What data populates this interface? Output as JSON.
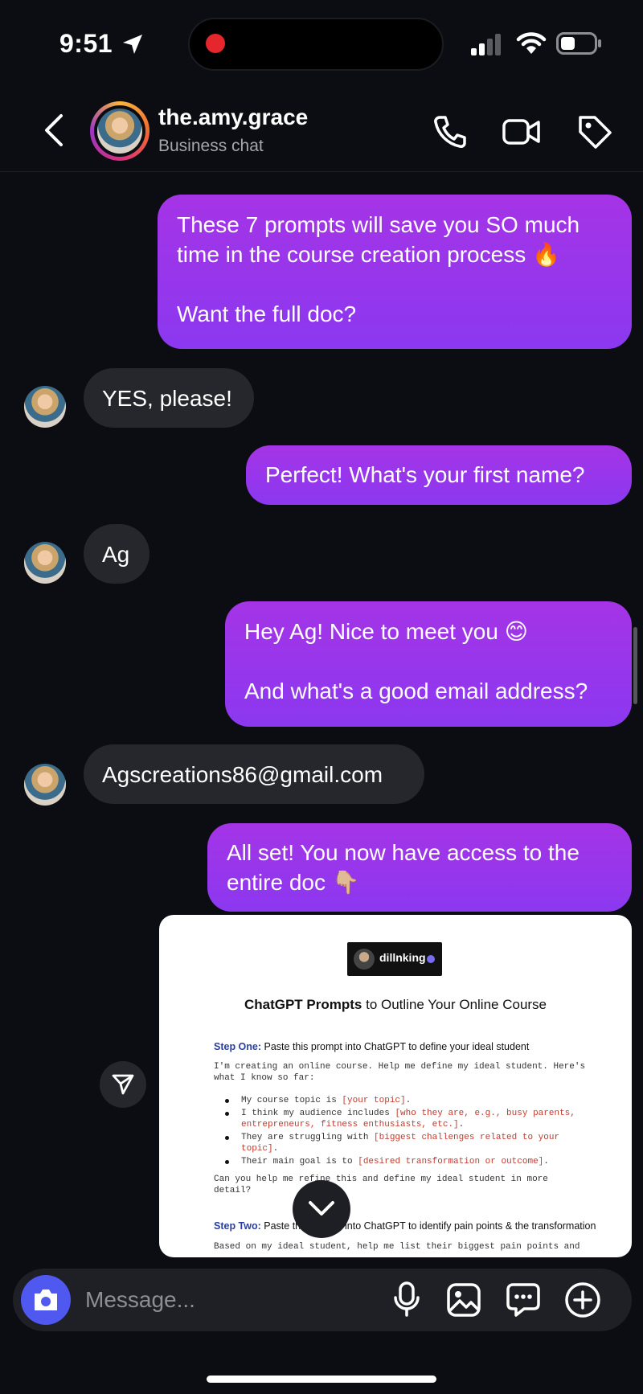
{
  "status_bar": {
    "time": "9:51"
  },
  "header": {
    "username": "the.amy.grace",
    "subtitle": "Business chat"
  },
  "messages": [
    {
      "from": "me",
      "text": "These 7 prompts will save you SO much\ntime in the course creation process 🔥\n\nWant the full doc?"
    },
    {
      "from": "them",
      "text": "YES, please!"
    },
    {
      "from": "me",
      "text": "Perfect! What's your first name?"
    },
    {
      "from": "them",
      "text": "Ag"
    },
    {
      "from": "me",
      "text": "Hey Ag! Nice to meet you 😊\n\nAnd what's a good email address?"
    },
    {
      "from": "them",
      "text": "Agscreations86@gmail.com"
    },
    {
      "from": "me",
      "text": "All set! You now have access to the\nentire doc 👇🏼"
    }
  ],
  "doc": {
    "logo_name": "dillnking",
    "title_bold": "ChatGPT Prompts",
    "title_rest": " to Outline Your Online Course",
    "step1_label": "Step One:",
    "step1_text": " Paste this prompt into ChatGPT to define your ideal student",
    "intro_line1": "I'm creating an online course. Help me define my ideal student. Here's",
    "intro_line2": "what I know so far:",
    "b1_a": "My course topic is ",
    "b1_b": "[your topic]",
    "b1_c": ".",
    "b2_a": "I think my audience includes ",
    "b2_b": "[who they are, e.g., busy parents,",
    "b2_c": "entrepreneurs, fitness enthusiasts, etc.]",
    "b2_d": ".",
    "b3_a": "They are struggling with ",
    "b3_b": "[biggest challenges related to your",
    "b3_c": "topic]",
    "b3_d": ".",
    "b4_a": "Their main goal is to ",
    "b4_b": "[desired transformation or outcome]",
    "b4_c": ".",
    "q_line1": "Can you help me refine this and define my ideal student in more",
    "q_line2": "detail?",
    "step2_label": "Step Two:",
    "step2_text": " Paste this prompt into ChatGPT to identify pain points & the transformation",
    "last_line": "Based on my ideal student, help me list their biggest pain points and"
  },
  "composer": {
    "placeholder": "Message..."
  },
  "colors": {
    "outgoing_bubble": "#9a36ea",
    "incoming_bubble": "#26272d",
    "camera_button": "#4f59f0",
    "background": "#0c0d12"
  }
}
